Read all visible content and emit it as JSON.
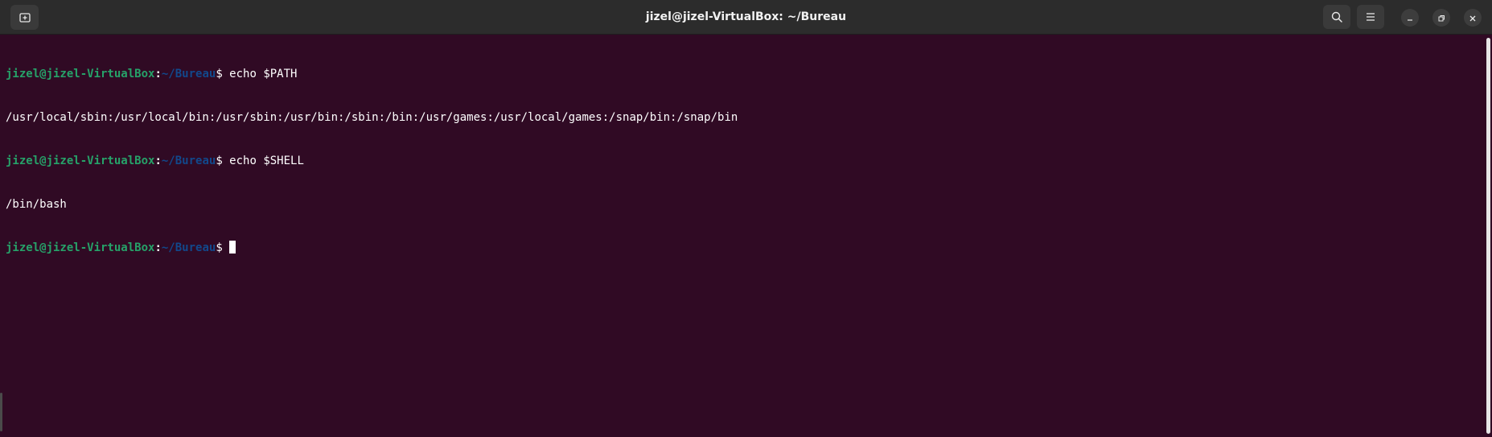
{
  "window": {
    "title": "jizel@jizel-VirtualBox: ~/Bureau"
  },
  "headerbar": {
    "new_tab_icon": "new-tab-icon",
    "search_icon": "search-icon",
    "menu_icon": "hamburger-menu-icon",
    "minimize_icon": "minimize-icon",
    "maximize_icon": "maximize-icon",
    "close_icon": "close-icon"
  },
  "terminal": {
    "lines": [
      {
        "type": "prompt",
        "user": "jizel@jizel-VirtualBox",
        "colon": ":",
        "path": "~/Bureau",
        "dollar": "$ ",
        "command": "echo $PATH"
      },
      {
        "type": "output",
        "text": "/usr/local/sbin:/usr/local/bin:/usr/sbin:/usr/bin:/sbin:/bin:/usr/games:/usr/local/games:/snap/bin:/snap/bin"
      },
      {
        "type": "prompt",
        "user": "jizel@jizel-VirtualBox",
        "colon": ":",
        "path": "~/Bureau",
        "dollar": "$ ",
        "command": "echo $SHELL"
      },
      {
        "type": "output",
        "text": "/bin/bash"
      },
      {
        "type": "prompt",
        "user": "jizel@jizel-VirtualBox",
        "colon": ":",
        "path": "~/Bureau",
        "dollar": "$ ",
        "command": ""
      }
    ]
  },
  "colors": {
    "background": "#300a24",
    "prompt_user": "#26a269",
    "prompt_path": "#12488b",
    "text": "#ffffff",
    "headerbar": "#2c2c2c"
  }
}
